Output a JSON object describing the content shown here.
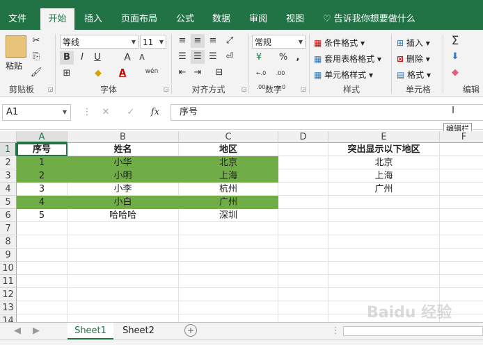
{
  "title_fragment": "...",
  "tabs": [
    "文件",
    "开始",
    "插入",
    "页面布局",
    "公式",
    "数据",
    "审阅",
    "视图"
  ],
  "active_tab": "开始",
  "tell_me": "告诉我你想要做什么",
  "ribbon": {
    "clipboard": {
      "paste": "粘贴",
      "label": "剪贴板"
    },
    "font": {
      "name": "等线",
      "size": "11",
      "label": "字体",
      "bold": "B",
      "italic": "I",
      "underline": "U",
      "grow": "A",
      "shrink": "A",
      "wen": "wén",
      "font_color_letter": "A"
    },
    "alignment": {
      "label": "对齐方式"
    },
    "number": {
      "format": "常规",
      "label": "数字",
      "percent": "%",
      "comma": ",",
      "inc": "←.0 .00",
      "dec": ".00 →.0"
    },
    "styles": {
      "conditional": "条件格式",
      "table": "套用表格格式",
      "cell": "单元格样式",
      "label": "样式"
    },
    "cells": {
      "insert": "插入",
      "delete": "删除",
      "format": "格式",
      "label": "单元格"
    },
    "editing": {
      "label": "编辑"
    }
  },
  "formula_bar": {
    "name_box": "A1",
    "content": "序号",
    "tooltip": "编辑栏",
    "fx": "fx"
  },
  "columns": [
    "A",
    "B",
    "C",
    "D",
    "E",
    "F"
  ],
  "rows": [
    "1",
    "2",
    "3",
    "4",
    "5",
    "6",
    "7",
    "8",
    "9",
    "10",
    "11",
    "12",
    "13",
    "14"
  ],
  "cells": {
    "A1": "序号",
    "B1": "姓名",
    "C1": "地区",
    "E1": "突出显示以下地区",
    "A2": "1",
    "B2": "小华",
    "C2": "北京",
    "E2": "北京",
    "A3": "2",
    "B3": "小明",
    "C3": "上海",
    "E3": "上海",
    "A4": "3",
    "B4": "小李",
    "C4": "杭州",
    "E4": "广州",
    "A5": "4",
    "B5": "小白",
    "C5": "广州",
    "A6": "5",
    "B6": "哈哈哈",
    "C6": "深圳"
  },
  "sheets": [
    "Sheet1",
    "Sheet2"
  ],
  "active_sheet": "Sheet1",
  "colors": {
    "excel_green": "#217346",
    "highlight": "#70ad47"
  },
  "watermark": "Baidu 经验"
}
